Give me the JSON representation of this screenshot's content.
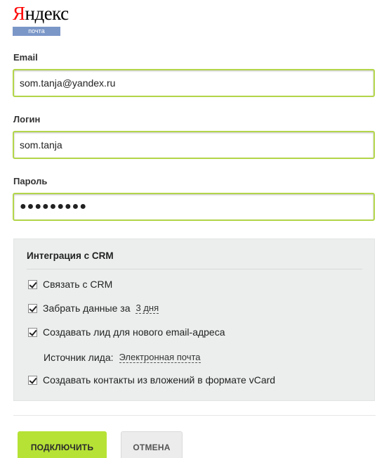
{
  "logo": {
    "first_letter": "Я",
    "rest": "ндекс",
    "badge": "почта"
  },
  "form": {
    "email": {
      "label": "Email",
      "value": "som.tanja@yandex.ru"
    },
    "login": {
      "label": "Логин",
      "value": "som.tanja"
    },
    "password": {
      "label": "Пароль",
      "value": "●●●●●●●●●"
    }
  },
  "crm": {
    "title": "Интеграция с CRM",
    "options": [
      {
        "label": "Связать с CRM",
        "checked": true
      },
      {
        "label": "Забрать данные за",
        "checked": true,
        "link": "3 дня"
      },
      {
        "label": "Создавать лид для нового email-адреса",
        "checked": true
      },
      {
        "label": "Создавать контакты из вложений в формате vCard",
        "checked": true
      }
    ],
    "lead_source": {
      "label": "Источник лида:",
      "value": "Электронная почта"
    }
  },
  "buttons": {
    "connect": "ПОДКЛЮЧИТЬ",
    "cancel": "ОТМЕНА"
  },
  "colors": {
    "accent": "#b6e236",
    "input_border": "#b3d64a",
    "logo_red": "#ff0000",
    "badge": "#7b97c8"
  }
}
